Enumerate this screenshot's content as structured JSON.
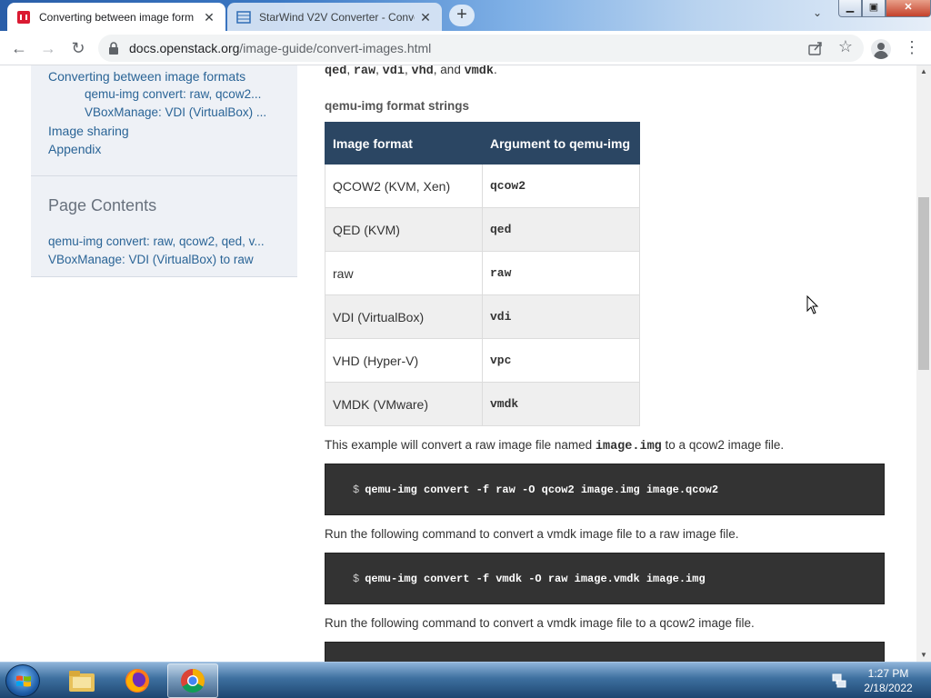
{
  "browser": {
    "tabs": [
      {
        "title": "Converting between image form",
        "active": true,
        "close": "✕"
      },
      {
        "title": "StarWind V2V Converter - Conve",
        "active": false,
        "close": "✕"
      }
    ],
    "new_tab": "+",
    "tab_search": "⌄",
    "window_controls": {
      "minimize": "▁",
      "maximize": "▣",
      "close": "✕"
    },
    "nav": {
      "back": "←",
      "forward": "→",
      "reload": "↻"
    },
    "url_host": "docs.openstack.org",
    "url_path": "/image-guide/convert-images.html",
    "bookmark": "☆",
    "menu": "⋮"
  },
  "sidebar": {
    "nav_items": [
      "Converting between image formats",
      "qemu-img convert: raw, qcow2...",
      "VBoxManage: VDI (VirtualBox) ...",
      "Image sharing",
      "Appendix"
    ],
    "page_contents_title": "Page Contents",
    "page_contents_items": [
      "qemu-img convert: raw, qcow2, qed, v...",
      "VBoxManage: VDI (VirtualBox) to raw"
    ]
  },
  "content": {
    "intro_codes": [
      "qed",
      "raw",
      "vdi",
      "vhd",
      "vmdk"
    ],
    "intro_sep1": ", ",
    "intro_sep_and": ", and ",
    "intro_end": ".",
    "table_caption": "qemu-img format strings",
    "table_headers": [
      "Image format",
      "Argument to qemu-img"
    ],
    "table_rows": [
      [
        "QCOW2 (KVM, Xen)",
        "qcow2"
      ],
      [
        "QED (KVM)",
        "qed"
      ],
      [
        "raw",
        "raw"
      ],
      [
        "VDI (VirtualBox)",
        "vdi"
      ],
      [
        "VHD (Hyper-V)",
        "vpc"
      ],
      [
        "VMDK (VMware)",
        "vmdk"
      ]
    ],
    "para1_a": "This example will convert a raw image file named ",
    "para1_code": "image.img",
    "para1_b": " to a qcow2 image file.",
    "code1_prompt": "$",
    "code1": "qemu-img convert -f raw -O qcow2 image.img image.qcow2",
    "para2": "Run the following command to convert a vmdk image file to a raw image file.",
    "code2_prompt": "$",
    "code2": "qemu-img convert -f vmdk -O raw image.vmdk image.img",
    "para3": "Run the following command to convert a vmdk image file to a qcow2 image file."
  },
  "scrollbar": {
    "up": "▲",
    "down": "▼"
  },
  "taskbar": {
    "time": "1:27 PM",
    "date": "2/18/2022"
  },
  "colors": {
    "table_header": "#2b4663",
    "link": "#2a6496",
    "code_bg": "#333333"
  }
}
